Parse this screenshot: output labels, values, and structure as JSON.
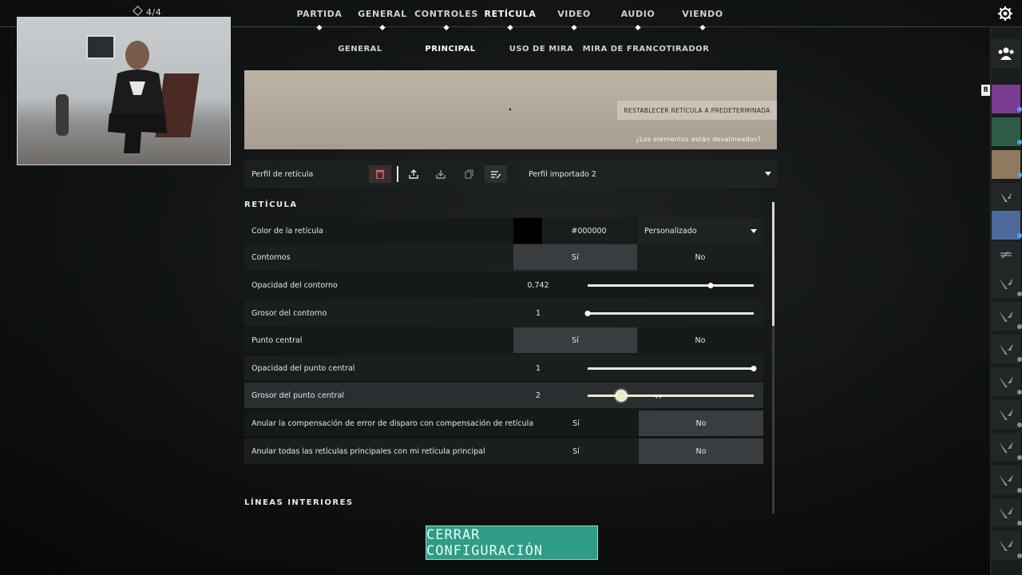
{
  "hud": {
    "player_count": "4/4"
  },
  "main_nav": {
    "items": [
      "PARTIDA",
      "GENERAL",
      "CONTROLES",
      "RETÍCULA",
      "VIDEO",
      "AUDIO",
      "VIENDO"
    ],
    "active": "RETÍCULA"
  },
  "sub_nav": {
    "items": [
      "GENERAL",
      "PRINCIPAL",
      "USO DE MIRA",
      "MIRA DE FRANCOTIRADOR"
    ],
    "active": "PRINCIPAL"
  },
  "preview": {
    "reset_label": "RESTABLECER RETÍCULA A PREDETERMINADA",
    "misaligned_label": "¿Los elementos están desalineados?"
  },
  "profile": {
    "label": "Perfil de retícula",
    "selected": "Perfil importado 2",
    "icons": [
      "delete-icon",
      "share-icon",
      "import-icon",
      "copy-icon",
      "rename-icon"
    ]
  },
  "section_crosshair": {
    "title": "RETÍCULA"
  },
  "settings": {
    "color": {
      "label": "Color de la retícula",
      "hex": "#000000",
      "mode": "Personalizado",
      "swatch": "#000000"
    },
    "outlines": {
      "label": "Contornos",
      "yes": "Sí",
      "no": "No",
      "value": "Sí"
    },
    "outline_opacity": {
      "label": "Opacidad del contorno",
      "value": "0,742",
      "fraction": 0.742
    },
    "outline_thickness": {
      "label": "Grosor del contorno",
      "value": "1",
      "fraction": 0.0
    },
    "center_dot": {
      "label": "Punto central",
      "yes": "Sí",
      "no": "No",
      "value": "Sí"
    },
    "center_dot_opacity": {
      "label": "Opacidad del punto central",
      "value": "1",
      "fraction": 1.0
    },
    "center_dot_thickness": {
      "label": "Grosor del punto central",
      "value": "2",
      "fraction": 0.2
    },
    "override_firing_error": {
      "label": "Anular la compensación de error de disparo con compensación de retícula",
      "yes": "Sí",
      "no": "No",
      "value": "No"
    },
    "override_all_primary": {
      "label": "Anular todas las retículas principales con mi retícula principal",
      "yes": "Sí",
      "no": "No",
      "value": "No"
    }
  },
  "section_inner": {
    "title": "LÍNEAS INTERIORES"
  },
  "footer": {
    "close_label": "CERRAR CONFIGURACIÓN"
  },
  "social": {
    "party_badge": "8"
  },
  "colors": {
    "accent": "#2e9c86",
    "preview_bg": "#b3a999"
  }
}
